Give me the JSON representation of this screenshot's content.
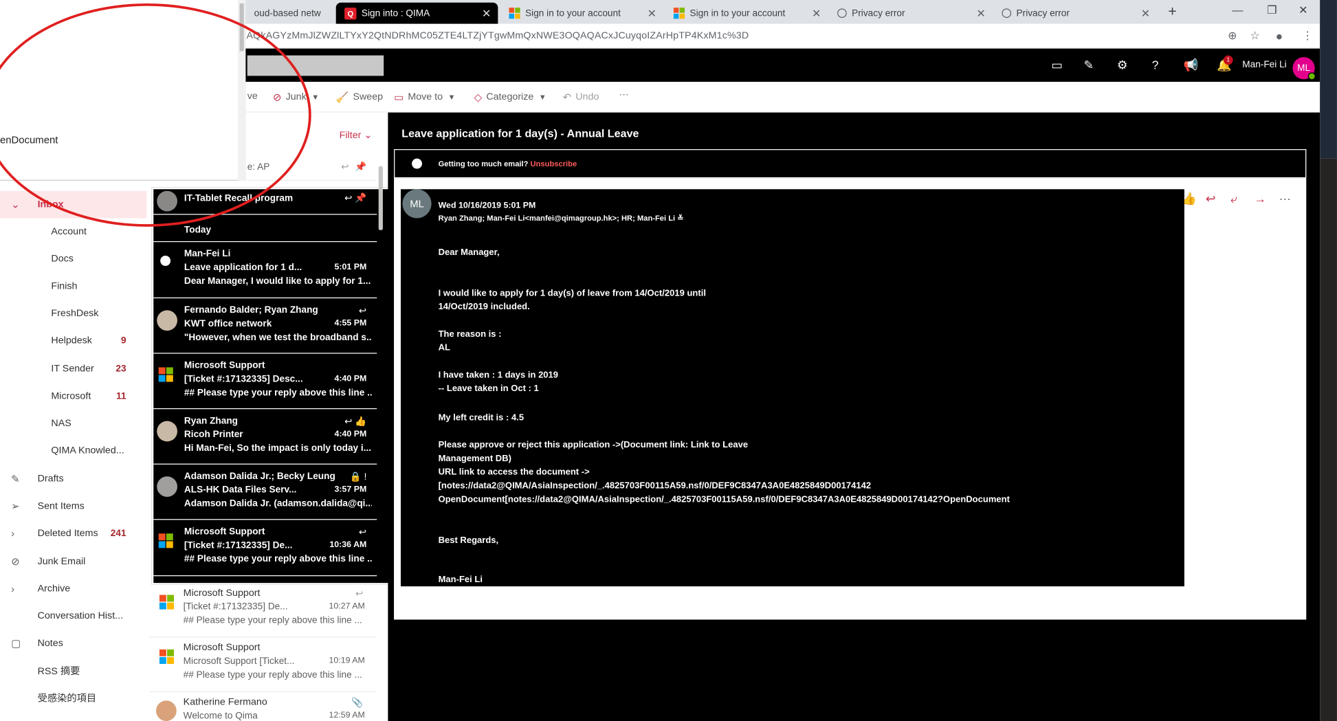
{
  "browser": {
    "tabs": [
      {
        "label": "oud-based netw",
        "favicon": "none"
      },
      {
        "label": "Sign into : QIMA",
        "favicon": "qima-icon",
        "active": true
      },
      {
        "label": "Sign in to your account",
        "favicon": "microsoft-icon"
      },
      {
        "label": "Sign in to your account",
        "favicon": "microsoft-icon"
      },
      {
        "label": "Privacy error",
        "favicon": "globe-icon"
      },
      {
        "label": "Privacy error",
        "favicon": "globe-icon"
      }
    ],
    "new_tab": "+",
    "url": "AQkAGYzMmJlZWZlLTYxY2QtNDRhMC05ZTE4LTZjYTgwMmQxNWE3OQAQACxJCuyqoIZArHpTP4KxM1c%3D"
  },
  "popup": {
    "text": "enDocument"
  },
  "header": {
    "user_name": "Man-Fei Li",
    "user_initials": "ML",
    "notification_count": "1"
  },
  "commands": {
    "archive": "ve",
    "junk": "Junk",
    "sweep": "Sweep",
    "move_to": "Move to",
    "categorize": "Categorize",
    "undo": "Undo",
    "more": "···"
  },
  "list": {
    "filter": "Filter",
    "pinned_subject": "e: AP"
  },
  "folders": [
    {
      "label": "Inbox",
      "count": "",
      "level": 1,
      "icon": "chevron-down-icon",
      "selected": true
    },
    {
      "label": "Account",
      "count": "",
      "level": 2
    },
    {
      "label": "Docs",
      "count": "",
      "level": 2
    },
    {
      "label": "Finish",
      "count": "",
      "level": 2
    },
    {
      "label": "FreshDesk",
      "count": "",
      "level": 2
    },
    {
      "label": "Helpdesk",
      "count": "9",
      "level": 2
    },
    {
      "label": "IT Sender",
      "count": "23",
      "level": 2
    },
    {
      "label": "Microsoft",
      "count": "11",
      "level": 2
    },
    {
      "label": "NAS",
      "count": "",
      "level": 2
    },
    {
      "label": "QIMA Knowled...",
      "count": "",
      "level": 2
    },
    {
      "label": "Drafts",
      "count": "",
      "level": 1,
      "icon": "pencil-icon"
    },
    {
      "label": "Sent Items",
      "count": "",
      "level": 1,
      "icon": "send-icon"
    },
    {
      "label": "Deleted Items",
      "count": "241",
      "level": 1,
      "icon": "chevron-right-icon"
    },
    {
      "label": "Junk Email",
      "count": "",
      "level": 1,
      "icon": "blocked-icon"
    },
    {
      "label": "Archive",
      "count": "",
      "level": 1,
      "icon": "chevron-right-icon"
    },
    {
      "label": "Conversation Hist...",
      "count": "",
      "level": 1
    },
    {
      "label": "Notes",
      "count": "",
      "level": 1,
      "icon": "note-icon"
    },
    {
      "label": "RSS 摘要",
      "count": "",
      "level": 1
    },
    {
      "label": "受感染的項目",
      "count": "",
      "level": 1
    }
  ],
  "black_messages": [
    {
      "sender": "",
      "subject": "IT-Tablet Recall program",
      "time": "",
      "preview": ""
    },
    {
      "sender": "",
      "subject": "Today",
      "time": "",
      "preview": ""
    },
    {
      "sender": "Man-Fei Li",
      "subject": "Leave application for 1 d...",
      "time": "5:01 PM",
      "preview": "Dear Manager, I would like to apply for 1..."
    },
    {
      "sender": "Fernando Balder; Ryan Zhang",
      "subject": "KWT office network",
      "time": "4:55 PM",
      "preview": "\"However, when we test the broadband s..."
    },
    {
      "sender": "Microsoft Support",
      "subject": "[Ticket #:17132335] Desc...",
      "time": "4:40 PM",
      "preview": "## Please type your reply above this line ..."
    },
    {
      "sender": "Ryan Zhang",
      "subject": "Ricoh Printer",
      "time": "4:40 PM",
      "preview": "Hi Man-Fei, So the impact is only today i..."
    },
    {
      "sender": "Adamson Dalida Jr.; Becky Leung",
      "subject": "ALS-HK Data Files Serv...",
      "time": "3:57 PM",
      "preview": "Adamson Dalida Jr. (adamson.dalida@qi..."
    },
    {
      "sender": "Microsoft Support",
      "subject": "[Ticket #:17132335] De...",
      "time": "10:36 AM",
      "preview": "## Please type your reply above this line ..."
    }
  ],
  "white_messages": [
    {
      "sender": "Microsoft Support",
      "subject": "[Ticket #:17132335] De...",
      "time": "10:27 AM",
      "preview": "## Please type your reply above this line ..."
    },
    {
      "sender": "Microsoft Support",
      "subject": "Microsoft Support [Ticket...",
      "time": "10:19 AM",
      "preview": "## Please type your reply above this line ..."
    },
    {
      "sender": "Katherine Fermano",
      "subject": "Welcome to Qima",
      "time": "12:59 AM",
      "preview": ""
    }
  ],
  "reading": {
    "subject": "Leave application for 1 day(s) - Annual Leave",
    "junk_notice": "Getting too much email? ",
    "junk_link": "Unsubscribe",
    "sender_initials": "ML",
    "date": "Wed 10/16/2019 5:01 PM",
    "recipients": "Ryan Zhang; Man-Fei Li<manfei@qimagroup.hk>; HR; Man-Fei Li ≚",
    "body_lines": [
      "Dear Manager,",
      "I would like to apply for 1 day(s) of leave from 14/Oct/2019 until",
      "14/Oct/2019 included.",
      "The reason is :",
      "AL",
      "I have taken : 1 days in 2019",
      "  -- Leave taken in Oct : 1",
      "My left credit is : 4.5",
      "Please approve or reject this application ->(Document link: Link to Leave",
      "Management DB)",
      "URL link to access the document ->",
      "[notes://data2@QIMA/AsiaInspection/_.4825703F00115A59.nsf/0/DEF9C8347A3A0E4825849D00174142",
      "OpenDocument[notes://data2@QIMA/AsiaInspection/_.4825703F00115A59.nsf/0/DEF9C8347A3A0E4825849D00174142?OpenDocument",
      "Best Regards,",
      "Man-Fei Li"
    ]
  },
  "colors": {
    "accent": "#c4314b",
    "avatar": "#e3008c",
    "annotation": "#e01f1f"
  }
}
